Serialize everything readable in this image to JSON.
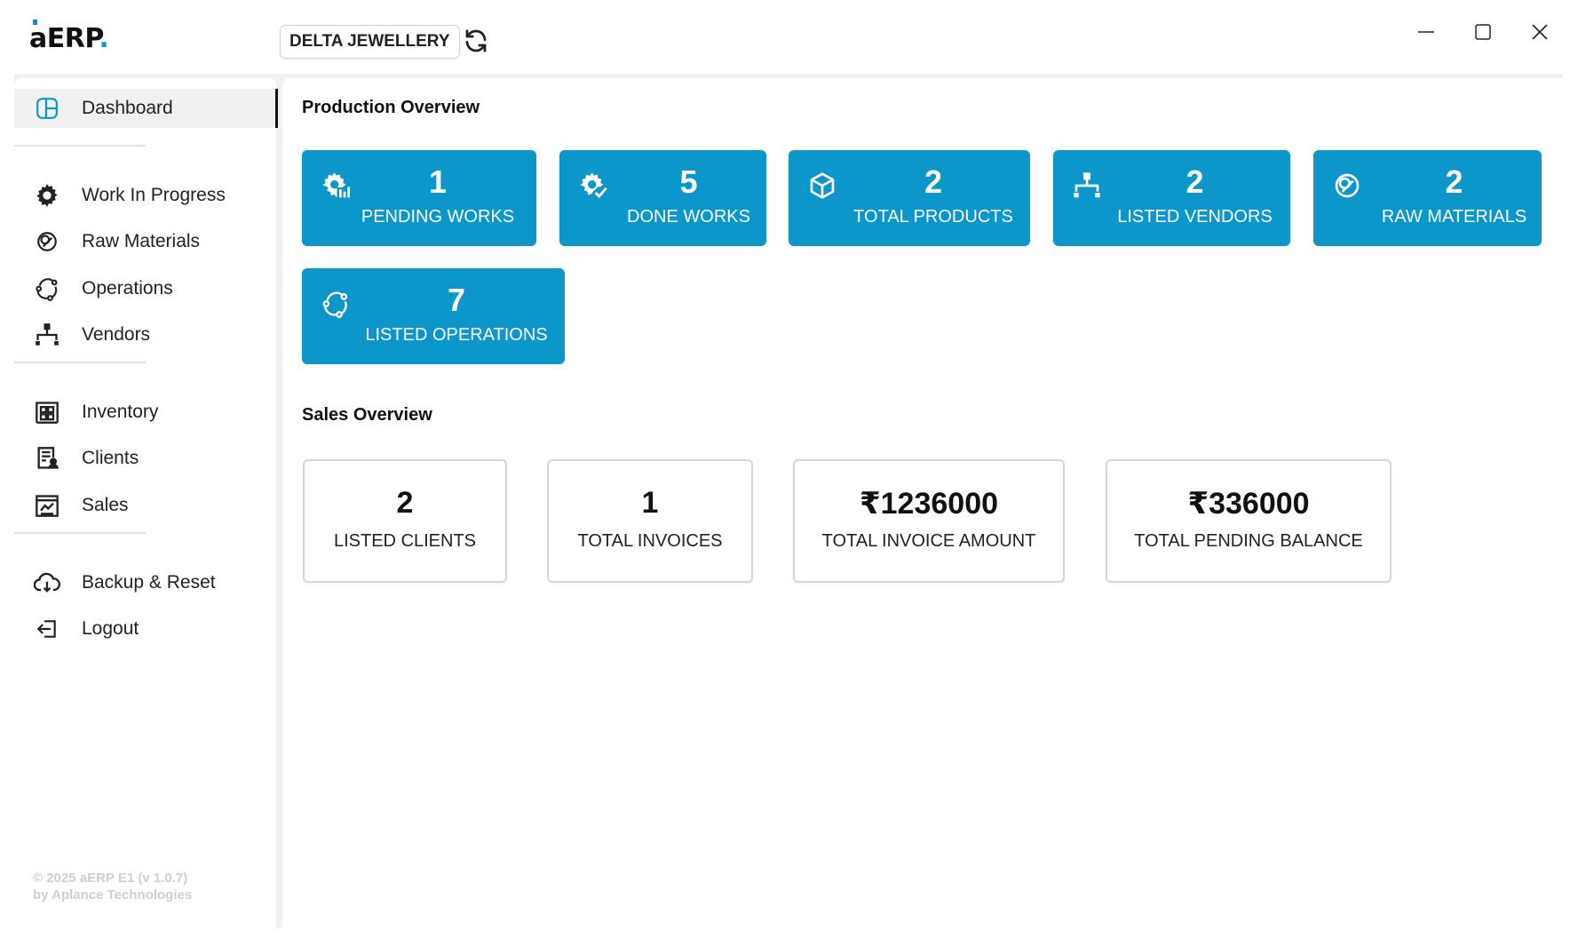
{
  "app": {
    "logo_text": "aERP",
    "logo_dot": ".",
    "company_name": "DELTA JEWELLERY"
  },
  "sidebar": {
    "items": [
      {
        "label": "Dashboard",
        "icon": "dashboard-icon",
        "active": true
      },
      {
        "label": "Work In Progress",
        "icon": "gear-icon"
      },
      {
        "label": "Raw Materials",
        "icon": "raw-materials-icon"
      },
      {
        "label": "Operations",
        "icon": "operations-icon"
      },
      {
        "label": "Vendors",
        "icon": "vendors-icon"
      },
      {
        "label": "Inventory",
        "icon": "inventory-icon"
      },
      {
        "label": "Clients",
        "icon": "clients-icon"
      },
      {
        "label": "Sales",
        "icon": "sales-icon"
      },
      {
        "label": "Backup & Reset",
        "icon": "cloud-icon"
      },
      {
        "label": "Logout",
        "icon": "logout-icon"
      }
    ],
    "copyright_line1": "© 2025 aERP E1 (v 1.0.7)",
    "copyright_line2": "by Aplance Technologies"
  },
  "production": {
    "title": "Production Overview",
    "cards": [
      {
        "value": "1",
        "label": "PENDING WORKS",
        "icon": "gear-pending-icon"
      },
      {
        "value": "5",
        "label": "DONE WORKS",
        "icon": "gear-done-icon"
      },
      {
        "value": "2",
        "label": "TOTAL PRODUCTS",
        "icon": "box-icon"
      },
      {
        "value": "2",
        "label": "LISTED VENDORS",
        "icon": "vendors-icon"
      },
      {
        "value": "2",
        "label": "RAW MATERIALS",
        "icon": "raw-materials-icon"
      },
      {
        "value": "7",
        "label": "LISTED OPERATIONS",
        "icon": "operations-icon"
      }
    ]
  },
  "sales": {
    "title": "Sales Overview",
    "cards": [
      {
        "value": "2",
        "label": "LISTED CLIENTS"
      },
      {
        "value": "1",
        "label": "TOTAL INVOICES"
      },
      {
        "value": "₹1236000",
        "label": "TOTAL INVOICE AMOUNT"
      },
      {
        "value": "₹336000",
        "label": "TOTAL PENDING BALANCE"
      }
    ]
  },
  "colors": {
    "accent": "#0b97c9",
    "background": "#f1f1f1",
    "card_border": "#d6d6d6"
  }
}
